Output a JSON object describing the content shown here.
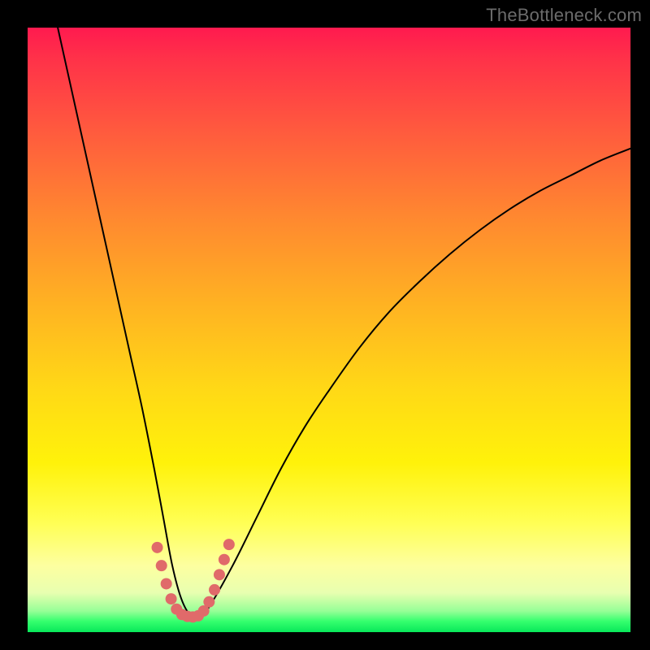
{
  "watermark": "TheBottleneck.com",
  "colors": {
    "frame": "#000000",
    "curve": "#000000",
    "marker": "#e06a6a"
  },
  "chart_data": {
    "type": "line",
    "title": "",
    "xlabel": "",
    "ylabel": "",
    "xlim": [
      0,
      100
    ],
    "ylim": [
      0,
      100
    ],
    "grid": false,
    "legend": false,
    "annotations": [],
    "series": [
      {
        "name": "bottleneck-curve",
        "x": [
          5,
          7,
          9,
          11,
          13,
          15,
          17,
          19,
          21,
          22.5,
          24,
          25.5,
          27,
          28.5,
          30,
          34,
          38,
          42,
          46,
          50,
          55,
          60,
          65,
          70,
          75,
          80,
          85,
          90,
          95,
          100
        ],
        "y": [
          100,
          91,
          82,
          73,
          64,
          55,
          46,
          37,
          27,
          19,
          11,
          5.5,
          2.8,
          2.5,
          4,
          11,
          19,
          27,
          34,
          40,
          47,
          53,
          58,
          62.5,
          66.5,
          70,
          73,
          75.5,
          78,
          80
        ]
      }
    ],
    "markers": {
      "name": "v-bottom-highlight",
      "color": "#e06a6a",
      "points": [
        {
          "x": 21.5,
          "y": 14
        },
        {
          "x": 22.2,
          "y": 11
        },
        {
          "x": 23.0,
          "y": 8
        },
        {
          "x": 23.8,
          "y": 5.5
        },
        {
          "x": 24.7,
          "y": 3.8
        },
        {
          "x": 25.6,
          "y": 2.9
        },
        {
          "x": 26.5,
          "y": 2.6
        },
        {
          "x": 27.4,
          "y": 2.5
        },
        {
          "x": 28.3,
          "y": 2.7
        },
        {
          "x": 29.2,
          "y": 3.5
        },
        {
          "x": 30.1,
          "y": 5
        },
        {
          "x": 31.0,
          "y": 7
        },
        {
          "x": 31.8,
          "y": 9.5
        },
        {
          "x": 32.6,
          "y": 12
        },
        {
          "x": 33.4,
          "y": 14.5
        }
      ]
    }
  }
}
